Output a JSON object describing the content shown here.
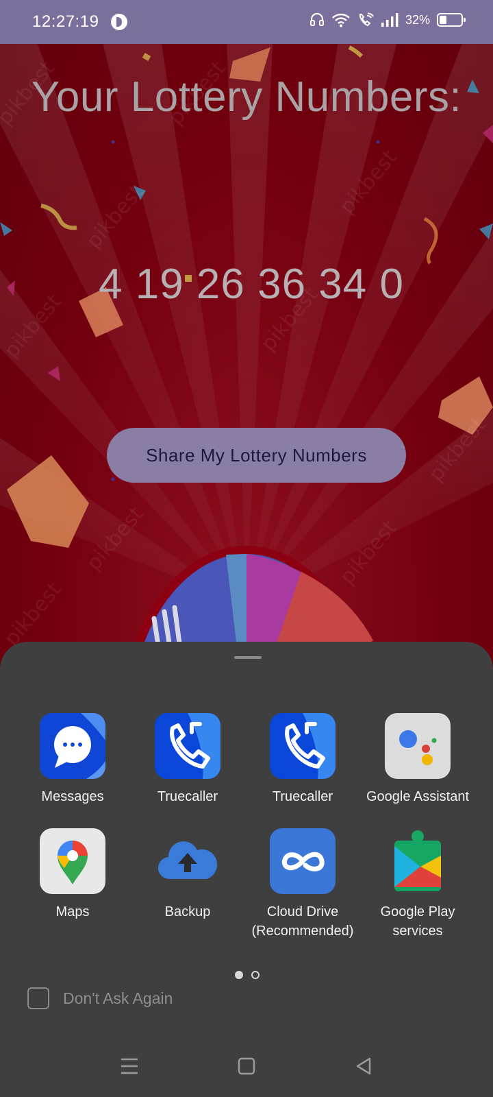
{
  "status_bar": {
    "time": "12:27:19",
    "battery": "32%",
    "icons": [
      "app-notification-icon",
      "headset-icon",
      "wifi-icon",
      "wifi-calling-icon",
      "signal-icon",
      "battery-icon"
    ]
  },
  "main": {
    "heading": "Your Lottery Numbers:",
    "numbers": "4 19 26 36 34 0",
    "share_button": "Share My Lottery Numbers",
    "watermark": "pikbest"
  },
  "share_sheet": {
    "apps": [
      {
        "label": "Messages",
        "icon": "messages-icon"
      },
      {
        "label": "Truecaller",
        "icon": "truecaller-icon"
      },
      {
        "label": "Truecaller",
        "icon": "truecaller-icon"
      },
      {
        "label": "Google Assistant",
        "icon": "google-assistant-icon"
      },
      {
        "label": "Maps",
        "icon": "maps-icon"
      },
      {
        "label": "Backup",
        "icon": "backup-cloud-icon"
      },
      {
        "label": "Cloud Drive (Recommended)",
        "icon": "cloud-drive-icon"
      },
      {
        "label": "Google Play services",
        "icon": "google-play-services-icon"
      }
    ],
    "page_indicator": {
      "current": 1,
      "total": 2
    },
    "dont_ask_label": "Don't Ask Again",
    "dont_ask_checked": false
  },
  "nav_bar": {
    "buttons": [
      "menu-icon",
      "home-icon",
      "back-icon"
    ]
  },
  "colors": {
    "status_bar": "#7b6f9b",
    "background": "#6e0010",
    "button": "#8b7ea5",
    "sheet": "#3f3f3f"
  }
}
